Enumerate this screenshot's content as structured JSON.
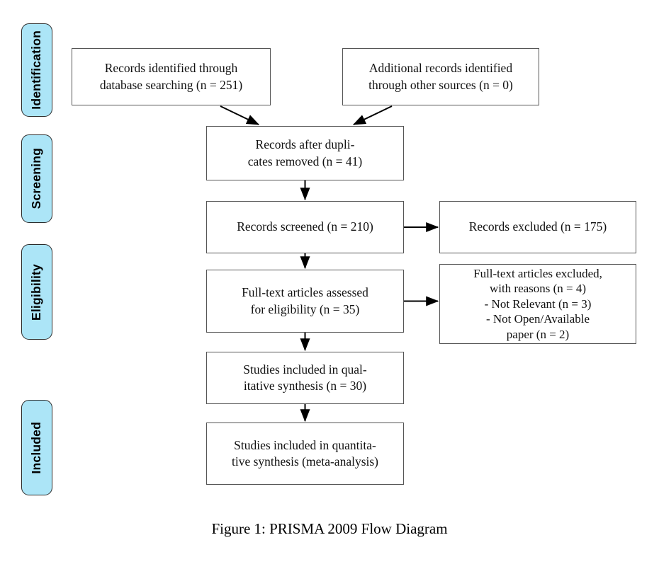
{
  "figure": {
    "caption": "Figure 1: PRISMA 2009 Flow Diagram",
    "colors": {
      "phase_pill_fill": "#ace5f7",
      "phase_pill_border": "#2b2b2b",
      "box_border": "#555555",
      "box_fill": "#ffffff",
      "arrow": "#000000",
      "text": "#000000",
      "background": "#ffffff"
    }
  },
  "phases": [
    {
      "id": "identification",
      "label": "Identification"
    },
    {
      "id": "screening",
      "label": "Screening"
    },
    {
      "id": "eligibility",
      "label": "Eligibility"
    },
    {
      "id": "included",
      "label": "Included"
    }
  ],
  "boxes": {
    "records_identified": {
      "id": "records-identified",
      "text": "Records identified through\ndatabase searching (n = 251)",
      "n": 251,
      "phase": "identification"
    },
    "additional_records": {
      "id": "additional-records",
      "text": "Additional records identified\nthrough other sources (n = 0)",
      "n": 0,
      "phase": "identification"
    },
    "duplicates_removed": {
      "id": "records-after-duplicates-removed",
      "text": "Records after dupli-\ncates removed (n = 41)",
      "n": 41,
      "phase": "screening"
    },
    "records_screened": {
      "id": "records-screened",
      "text": "Records screened (n = 210)",
      "n": 210,
      "phase": "screening"
    },
    "records_excluded": {
      "id": "records-excluded",
      "text": "Records excluded (n = 175)",
      "n": 175,
      "phase": "screening"
    },
    "fulltext_assessed": {
      "id": "full-text-articles-assessed",
      "text": "Full-text articles assessed\nfor eligibility (n = 35)",
      "n": 35,
      "phase": "eligibility"
    },
    "fulltext_excluded": {
      "id": "full-text-articles-excluded",
      "text": "Full-text articles excluded,\nwith reasons (n = 4)\n- Not Relevant (n = 3)\n- Not Open/Available\npaper (n = 2)",
      "n": 4,
      "reasons": [
        {
          "label": "Not Relevant",
          "n": 3
        },
        {
          "label": "Not Open/Available paper",
          "n": 2
        }
      ],
      "phase": "eligibility"
    },
    "qualitative": {
      "id": "studies-included-qualitative",
      "text": "Studies included in qual-\nitative synthesis (n = 30)",
      "n": 30,
      "phase": "included"
    },
    "quantitative": {
      "id": "studies-included-quantitative",
      "text": "Studies included in quantita-\ntive synthesis (meta-analysis)",
      "n": null,
      "phase": "included"
    }
  },
  "flows": [
    {
      "from": "records_identified",
      "to": "duplicates_removed",
      "kind": "diagonal"
    },
    {
      "from": "additional_records",
      "to": "duplicates_removed",
      "kind": "diagonal"
    },
    {
      "from": "duplicates_removed",
      "to": "records_screened",
      "kind": "vertical"
    },
    {
      "from": "records_screened",
      "to": "records_excluded",
      "kind": "horizontal"
    },
    {
      "from": "records_screened",
      "to": "fulltext_assessed",
      "kind": "vertical"
    },
    {
      "from": "fulltext_assessed",
      "to": "fulltext_excluded",
      "kind": "horizontal"
    },
    {
      "from": "fulltext_assessed",
      "to": "qualitative",
      "kind": "vertical"
    },
    {
      "from": "qualitative",
      "to": "quantitative",
      "kind": "vertical"
    }
  ]
}
